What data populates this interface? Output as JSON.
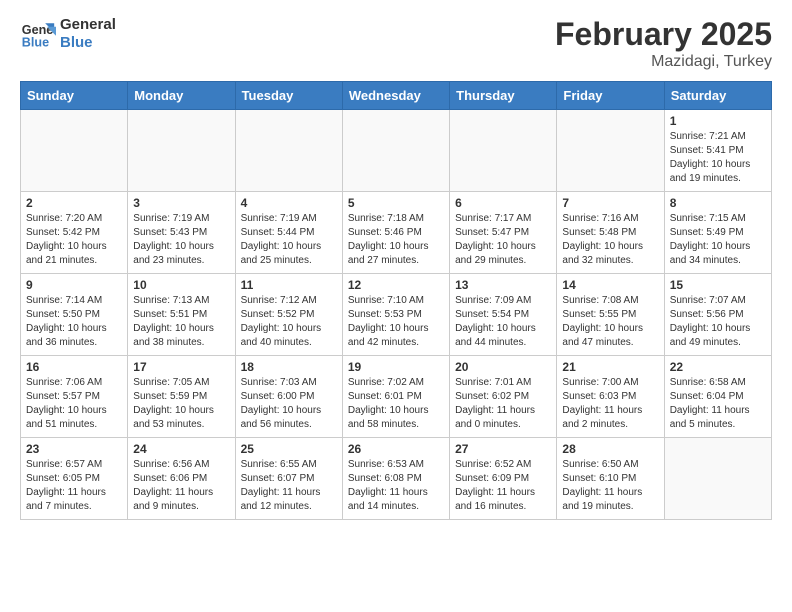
{
  "header": {
    "logo_line1": "General",
    "logo_line2": "Blue",
    "month_title": "February 2025",
    "location": "Mazidagi, Turkey"
  },
  "days_of_week": [
    "Sunday",
    "Monday",
    "Tuesday",
    "Wednesday",
    "Thursday",
    "Friday",
    "Saturday"
  ],
  "weeks": [
    [
      {
        "day": "",
        "info": ""
      },
      {
        "day": "",
        "info": ""
      },
      {
        "day": "",
        "info": ""
      },
      {
        "day": "",
        "info": ""
      },
      {
        "day": "",
        "info": ""
      },
      {
        "day": "",
        "info": ""
      },
      {
        "day": "1",
        "info": "Sunrise: 7:21 AM\nSunset: 5:41 PM\nDaylight: 10 hours\nand 19 minutes."
      }
    ],
    [
      {
        "day": "2",
        "info": "Sunrise: 7:20 AM\nSunset: 5:42 PM\nDaylight: 10 hours\nand 21 minutes."
      },
      {
        "day": "3",
        "info": "Sunrise: 7:19 AM\nSunset: 5:43 PM\nDaylight: 10 hours\nand 23 minutes."
      },
      {
        "day": "4",
        "info": "Sunrise: 7:19 AM\nSunset: 5:44 PM\nDaylight: 10 hours\nand 25 minutes."
      },
      {
        "day": "5",
        "info": "Sunrise: 7:18 AM\nSunset: 5:46 PM\nDaylight: 10 hours\nand 27 minutes."
      },
      {
        "day": "6",
        "info": "Sunrise: 7:17 AM\nSunset: 5:47 PM\nDaylight: 10 hours\nand 29 minutes."
      },
      {
        "day": "7",
        "info": "Sunrise: 7:16 AM\nSunset: 5:48 PM\nDaylight: 10 hours\nand 32 minutes."
      },
      {
        "day": "8",
        "info": "Sunrise: 7:15 AM\nSunset: 5:49 PM\nDaylight: 10 hours\nand 34 minutes."
      }
    ],
    [
      {
        "day": "9",
        "info": "Sunrise: 7:14 AM\nSunset: 5:50 PM\nDaylight: 10 hours\nand 36 minutes."
      },
      {
        "day": "10",
        "info": "Sunrise: 7:13 AM\nSunset: 5:51 PM\nDaylight: 10 hours\nand 38 minutes."
      },
      {
        "day": "11",
        "info": "Sunrise: 7:12 AM\nSunset: 5:52 PM\nDaylight: 10 hours\nand 40 minutes."
      },
      {
        "day": "12",
        "info": "Sunrise: 7:10 AM\nSunset: 5:53 PM\nDaylight: 10 hours\nand 42 minutes."
      },
      {
        "day": "13",
        "info": "Sunrise: 7:09 AM\nSunset: 5:54 PM\nDaylight: 10 hours\nand 44 minutes."
      },
      {
        "day": "14",
        "info": "Sunrise: 7:08 AM\nSunset: 5:55 PM\nDaylight: 10 hours\nand 47 minutes."
      },
      {
        "day": "15",
        "info": "Sunrise: 7:07 AM\nSunset: 5:56 PM\nDaylight: 10 hours\nand 49 minutes."
      }
    ],
    [
      {
        "day": "16",
        "info": "Sunrise: 7:06 AM\nSunset: 5:57 PM\nDaylight: 10 hours\nand 51 minutes."
      },
      {
        "day": "17",
        "info": "Sunrise: 7:05 AM\nSunset: 5:59 PM\nDaylight: 10 hours\nand 53 minutes."
      },
      {
        "day": "18",
        "info": "Sunrise: 7:03 AM\nSunset: 6:00 PM\nDaylight: 10 hours\nand 56 minutes."
      },
      {
        "day": "19",
        "info": "Sunrise: 7:02 AM\nSunset: 6:01 PM\nDaylight: 10 hours\nand 58 minutes."
      },
      {
        "day": "20",
        "info": "Sunrise: 7:01 AM\nSunset: 6:02 PM\nDaylight: 11 hours\nand 0 minutes."
      },
      {
        "day": "21",
        "info": "Sunrise: 7:00 AM\nSunset: 6:03 PM\nDaylight: 11 hours\nand 2 minutes."
      },
      {
        "day": "22",
        "info": "Sunrise: 6:58 AM\nSunset: 6:04 PM\nDaylight: 11 hours\nand 5 minutes."
      }
    ],
    [
      {
        "day": "23",
        "info": "Sunrise: 6:57 AM\nSunset: 6:05 PM\nDaylight: 11 hours\nand 7 minutes."
      },
      {
        "day": "24",
        "info": "Sunrise: 6:56 AM\nSunset: 6:06 PM\nDaylight: 11 hours\nand 9 minutes."
      },
      {
        "day": "25",
        "info": "Sunrise: 6:55 AM\nSunset: 6:07 PM\nDaylight: 11 hours\nand 12 minutes."
      },
      {
        "day": "26",
        "info": "Sunrise: 6:53 AM\nSunset: 6:08 PM\nDaylight: 11 hours\nand 14 minutes."
      },
      {
        "day": "27",
        "info": "Sunrise: 6:52 AM\nSunset: 6:09 PM\nDaylight: 11 hours\nand 16 minutes."
      },
      {
        "day": "28",
        "info": "Sunrise: 6:50 AM\nSunset: 6:10 PM\nDaylight: 11 hours\nand 19 minutes."
      },
      {
        "day": "",
        "info": ""
      }
    ]
  ]
}
